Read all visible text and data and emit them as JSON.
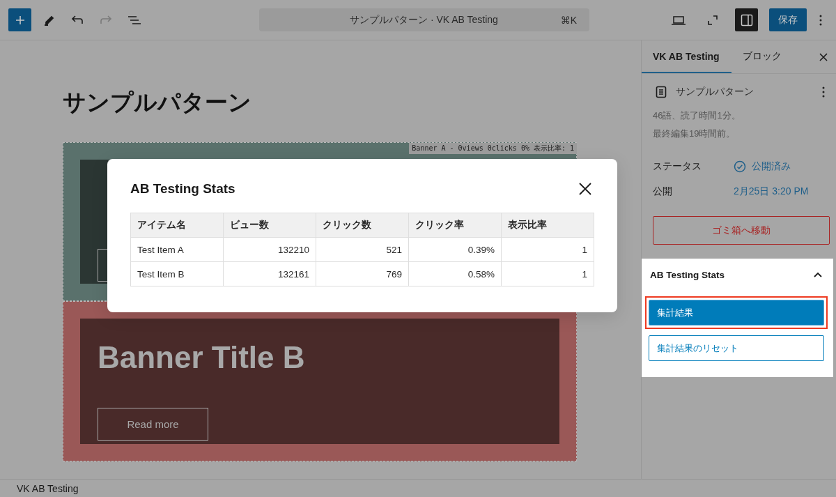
{
  "toolbar": {
    "tools": [
      {
        "kind": "add"
      },
      {
        "kind": "edit"
      },
      {
        "kind": "undo"
      },
      {
        "kind": "redo",
        "disabled": true
      },
      {
        "kind": "outline"
      }
    ],
    "command_bar": {
      "title": "サンプルパターン · VK AB Testing",
      "shortcut": "⌘K"
    },
    "view_tools": [
      {
        "kind": "preview",
        "selected": false
      },
      {
        "kind": "fullscreen",
        "selected": false
      },
      {
        "kind": "settings",
        "selected": true
      }
    ],
    "save_button": "保存"
  },
  "editor": {
    "page_title": "サンプルパターン",
    "banners": [
      {
        "color": "#5a716c",
        "label": "Banner A - 0views 0clicks 0% 表示比率: 1"
      },
      {
        "color": "#9a5857",
        "title": "Banner Title B",
        "button": "Read more"
      }
    ]
  },
  "modal": {
    "title": "AB Testing Stats",
    "columns": [
      "アイテム名",
      "ビュー数",
      "クリック数",
      "クリック率",
      "表示比率"
    ],
    "rows": [
      [
        "Test Item A",
        "132210",
        "521",
        "0.39%",
        "1"
      ],
      [
        "Test Item B",
        "132161",
        "769",
        "0.58%",
        "1"
      ]
    ]
  },
  "sidebar": {
    "tabs": [
      {
        "label": "VK AB Testing",
        "selected": true
      },
      {
        "label": "ブロック",
        "selected": false
      }
    ],
    "document": {
      "title": "サンプルパターン",
      "details": [
        "46語、読了時間1分。",
        "最終編集19時間前。"
      ]
    },
    "fields": [
      {
        "label": "ステータス",
        "value": "公開済み",
        "kind": "status"
      },
      {
        "label": "公開",
        "value": "2月25日 3:20 PM",
        "kind": "date"
      }
    ],
    "trash_button": "ゴミ箱へ移動",
    "stats_panel": {
      "title": "AB Testing Stats",
      "expanded": true,
      "buttons": [
        {
          "label": "集計結果",
          "kind": "primary",
          "highlighted": true
        },
        {
          "label": "集計結果のリセット",
          "kind": "secondary",
          "highlighted": false
        }
      ]
    }
  },
  "status_bar": "VK AB Testing"
}
